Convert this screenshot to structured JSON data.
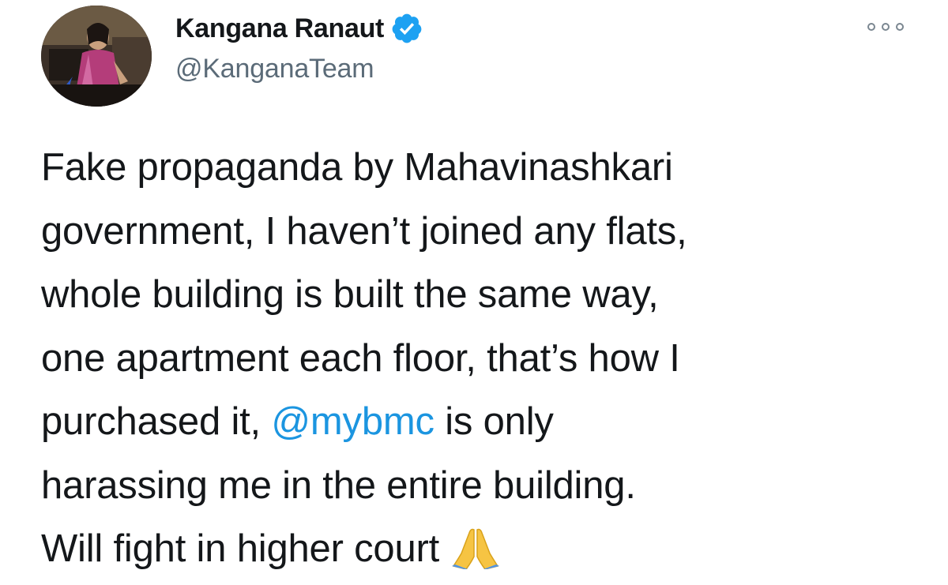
{
  "author": {
    "display_name": "Kangana Ranaut",
    "handle": "@KanganaTeam",
    "verified": true,
    "avatar_icon": "profile-photo"
  },
  "menu": {
    "icon": "more-options-icon"
  },
  "tweet": {
    "lines": [
      "Fake propaganda by Mahavinashkari",
      "government, I haven’t joined any flats,",
      "whole building is built the same way,",
      "one apartment each floor, that’s how I"
    ],
    "line5_before": "purchased it, ",
    "mention": "@mybmc",
    "line5_after": " is only",
    "line6": "harassing me in the entire building.",
    "line7": "Will fight in higher court",
    "emoji": "folded-hands-emoji"
  },
  "colors": {
    "text": "#14171a",
    "secondary": "#5b6b78",
    "link": "#1b95e0",
    "verified": "#1da1f2"
  }
}
